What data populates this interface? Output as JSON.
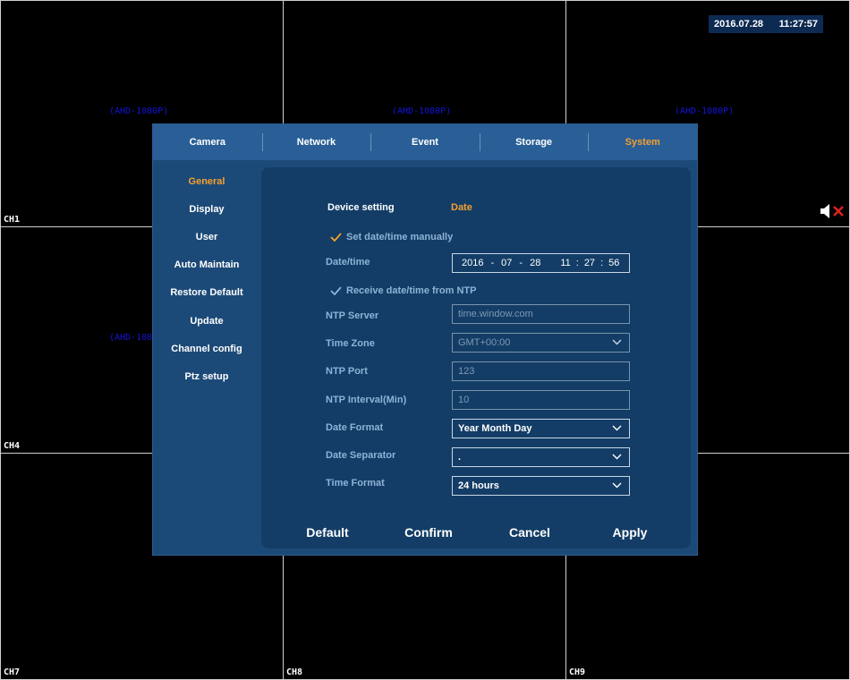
{
  "clock": {
    "date": "2016.07.28",
    "time": "11:27:57"
  },
  "channels": [
    {
      "label": "CH1",
      "res": "(AHD-1080P)"
    },
    {
      "label": "",
      "res": "(AHD-1080P)"
    },
    {
      "label": "",
      "res": "(AHD-1080P)"
    },
    {
      "label": "CH4",
      "res": "(AHD-108"
    },
    {
      "label": "",
      "res": ""
    },
    {
      "label": "",
      "res": ""
    },
    {
      "label": "CH7",
      "res": ""
    },
    {
      "label": "CH8",
      "res": ""
    },
    {
      "label": "CH9",
      "res": ""
    }
  ],
  "tabs": [
    "Camera",
    "Network",
    "Event",
    "Storage",
    "System"
  ],
  "active_tab": "System",
  "sidebar": [
    "General",
    "Display",
    "User",
    "Auto Maintain",
    "Restore Default",
    "Update",
    "Channel config",
    "Ptz setup"
  ],
  "active_sidebar": "General",
  "form": {
    "device_setting_label": "Device setting",
    "device_setting_value": "Date",
    "set_manual_label": "Set date/time manually",
    "datetime_label": "Date/time",
    "datetime": {
      "year": "2016",
      "month": "07",
      "day": "28",
      "hour": "11",
      "minute": "27",
      "second": "56",
      "date_sep": "-",
      "time_sep": ":"
    },
    "ntp_check_label": "Receive date/time from NTP",
    "ntp_server_label": "NTP Server",
    "ntp_server_value": "time.window.com",
    "time_zone_label": "Time Zone",
    "time_zone_value": "GMT+00:00",
    "ntp_port_label": "NTP Port",
    "ntp_port_value": "123",
    "ntp_interval_label": "NTP Interval(Min)",
    "ntp_interval_value": "10",
    "date_format_label": "Date Format",
    "date_format_value": "Year Month Day",
    "date_separator_label": "Date Separator",
    "date_separator_value": ".",
    "time_format_label": "Time Format",
    "time_format_value": "24 hours"
  },
  "buttons": {
    "default": "Default",
    "confirm": "Confirm",
    "cancel": "Cancel",
    "apply": "Apply"
  },
  "colors": {
    "accent": "#f5a030",
    "dialog_bg": "#1c4a78",
    "panel_bg": "#133d66",
    "tab_bg": "#295f96",
    "res_text": "#1414d6"
  },
  "icons": {
    "mute": "speaker-muted-icon",
    "check": "checkmark-icon",
    "dropdown": "chevron-down-icon"
  }
}
